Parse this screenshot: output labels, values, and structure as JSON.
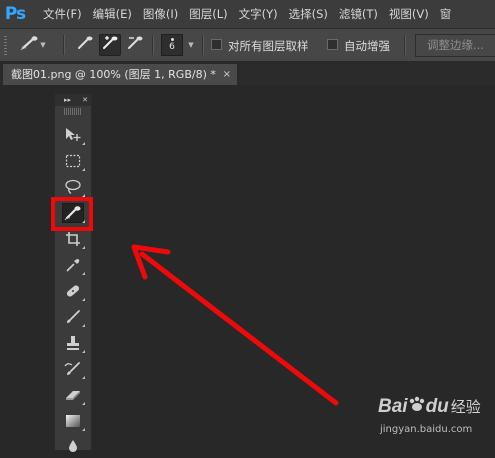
{
  "app": {
    "logo": "Ps"
  },
  "menu": [
    "文件(F)",
    "编辑(E)",
    "图像(I)",
    "图层(L)",
    "文字(Y)",
    "选择(S)",
    "滤镜(T)",
    "视图(V)",
    "窗"
  ],
  "options": {
    "brush_size": "6",
    "sample_all_layers_label": "对所有图层取样",
    "sample_all_layers_checked": false,
    "auto_enhance_label": "自动增强",
    "auto_enhance_checked": false,
    "refine_edge_label": "调整边缘..."
  },
  "document": {
    "tab_title": "截图01.png @ 100% (图层 1, RGB/8) *",
    "close_glyph": "×"
  },
  "toolbox": {
    "collapse_glyph": "▸▸",
    "close_glyph": "✕",
    "tools": [
      {
        "icon": "move-tool-icon",
        "selected": false
      },
      {
        "icon": "rectangular-marquee-icon",
        "selected": false
      },
      {
        "icon": "lasso-icon",
        "selected": false
      },
      {
        "icon": "quick-selection-icon",
        "selected": true
      },
      {
        "icon": "crop-icon",
        "selected": false
      },
      {
        "icon": "eyedropper-icon",
        "selected": false
      },
      {
        "icon": "healing-brush-icon",
        "selected": false
      },
      {
        "icon": "brush-icon",
        "selected": false
      },
      {
        "icon": "clone-stamp-icon",
        "selected": false
      },
      {
        "icon": "history-brush-icon",
        "selected": false
      },
      {
        "icon": "eraser-icon",
        "selected": false
      },
      {
        "icon": "gradient-icon",
        "selected": false
      },
      {
        "icon": "blur-icon",
        "selected": false
      }
    ]
  },
  "annotation": {
    "color": "#ee0a0a"
  },
  "watermark": {
    "brand": "Bai",
    "brand_suffix": "du",
    "product": "经验",
    "url": "jingyan.baidu.com"
  }
}
